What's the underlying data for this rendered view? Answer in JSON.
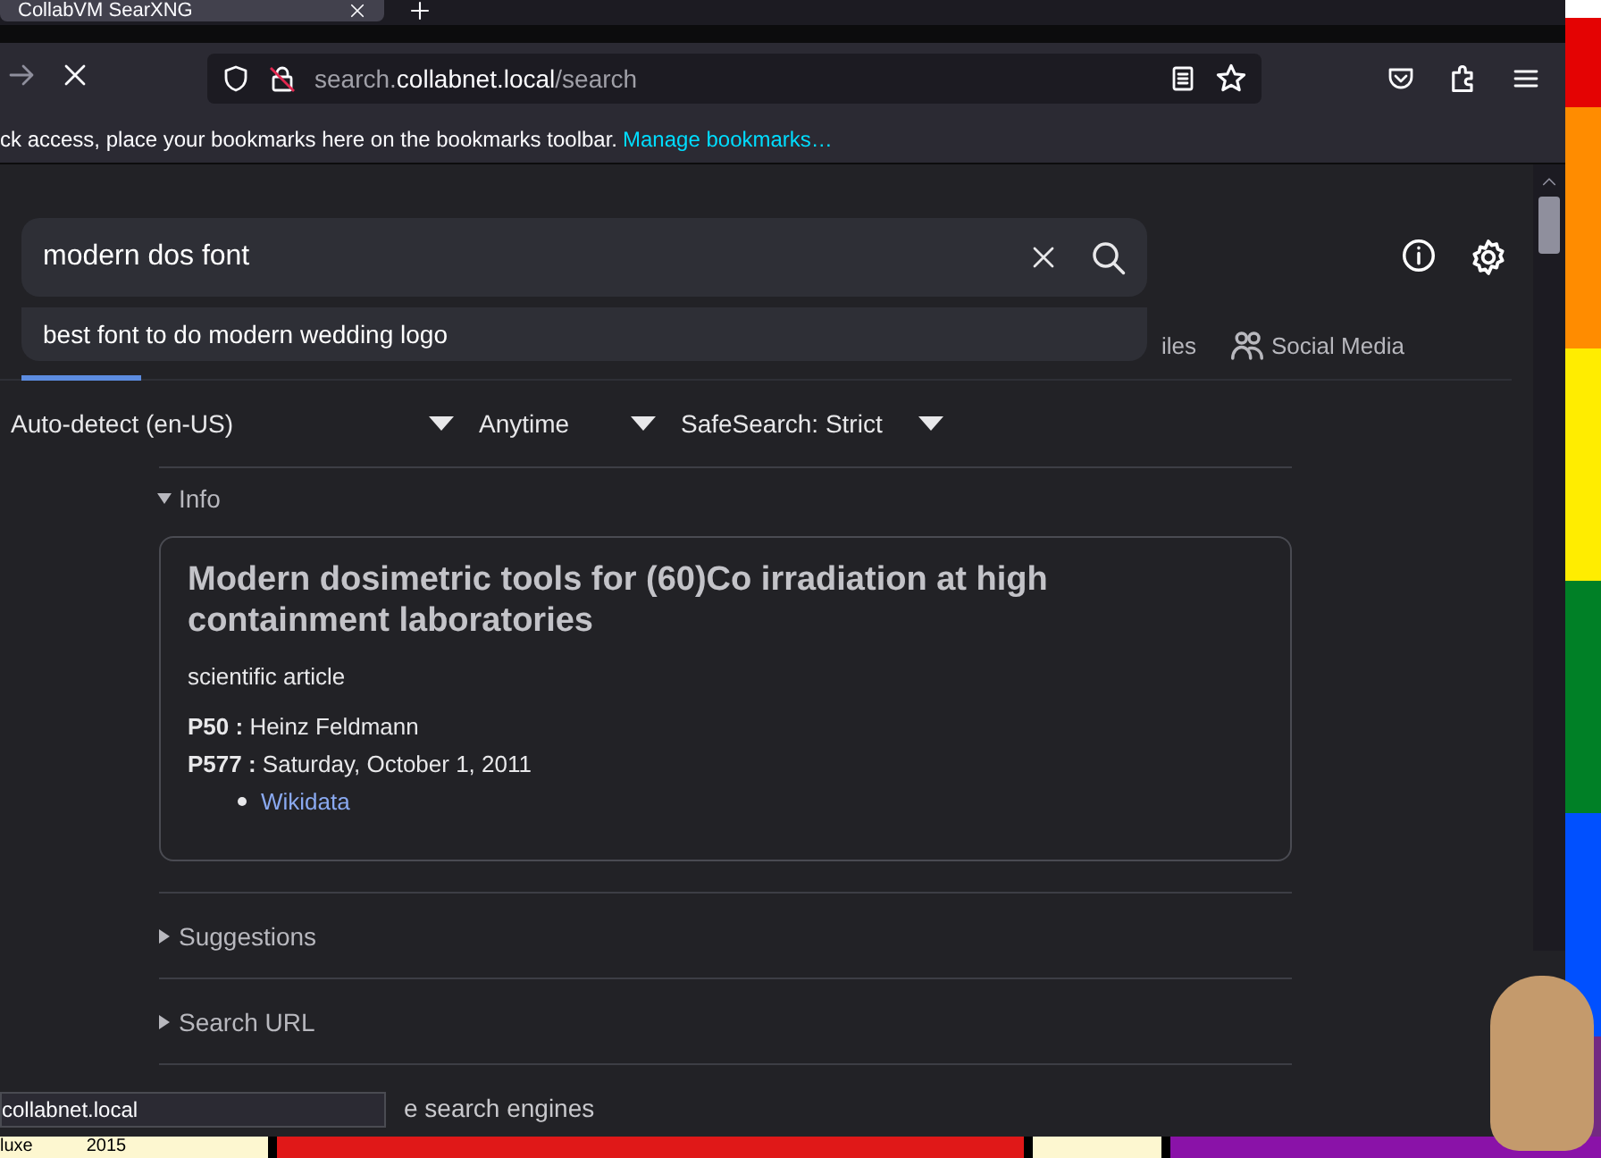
{
  "browser": {
    "tab": {
      "title": "CollabVM SearXNG"
    },
    "address": {
      "host_prefix": "search.",
      "host": "collabnet.local",
      "path": "/search"
    },
    "loading": true,
    "bookmarks_bar": {
      "message": "ck access, place your bookmarks here on the bookmarks toolbar.",
      "link": "Manage bookmarks…"
    }
  },
  "search": {
    "value": "modern dos font",
    "suggestions": [
      "best font to do modern wedding logo"
    ]
  },
  "categories": [
    {
      "label": "iles"
    },
    {
      "label": "Social Media"
    }
  ],
  "filters": [
    {
      "value": "Auto-detect (en-US)"
    },
    {
      "value": "Anytime"
    },
    {
      "value": "SafeSearch: Strict"
    }
  ],
  "info": {
    "label": "Info",
    "expanded": true,
    "title": "Modern dosimetric tools for (60)Co irradiation at high containment laboratories",
    "description": "scientific article",
    "attributes": [
      {
        "key": "P50 :",
        "value": "Heinz Feldmann"
      },
      {
        "key": "P577 :",
        "value": "Saturday, October 1, 2011"
      }
    ],
    "links": [
      "Wikidata"
    ]
  },
  "sections": [
    {
      "label": "Suggestions",
      "expanded": false
    },
    {
      "label": "Search URL",
      "expanded": false
    }
  ],
  "partial_section": "e search engines",
  "status_text": "collabnet.local",
  "desktop": {
    "texts": [
      "luxe",
      "2015"
    ]
  }
}
